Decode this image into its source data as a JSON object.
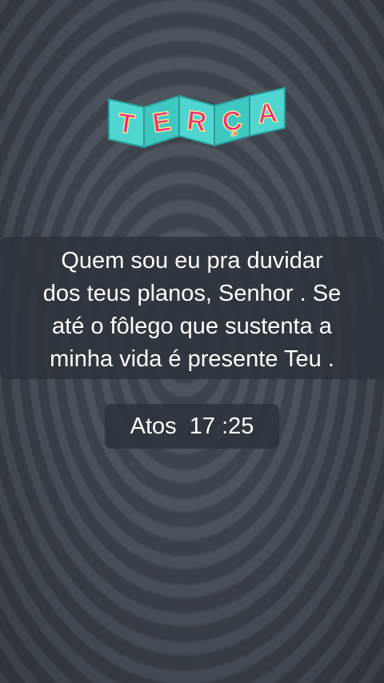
{
  "sticker": {
    "letters": [
      "T",
      "E",
      "R",
      "Ç",
      "A"
    ],
    "colors": {
      "panel": "#4fd6d0",
      "panel_dark": "#2bb3ae",
      "letter": "#e8327c",
      "bulb": "#ffe58a"
    }
  },
  "quote": {
    "lines": [
      "Quem sou eu pra duvidar",
      "dos teus planos, Senhor . Se",
      "até o fôlego que sustenta a",
      "minha vida é presente Teu ."
    ]
  },
  "reference": {
    "text": "Atos  17 :25"
  }
}
